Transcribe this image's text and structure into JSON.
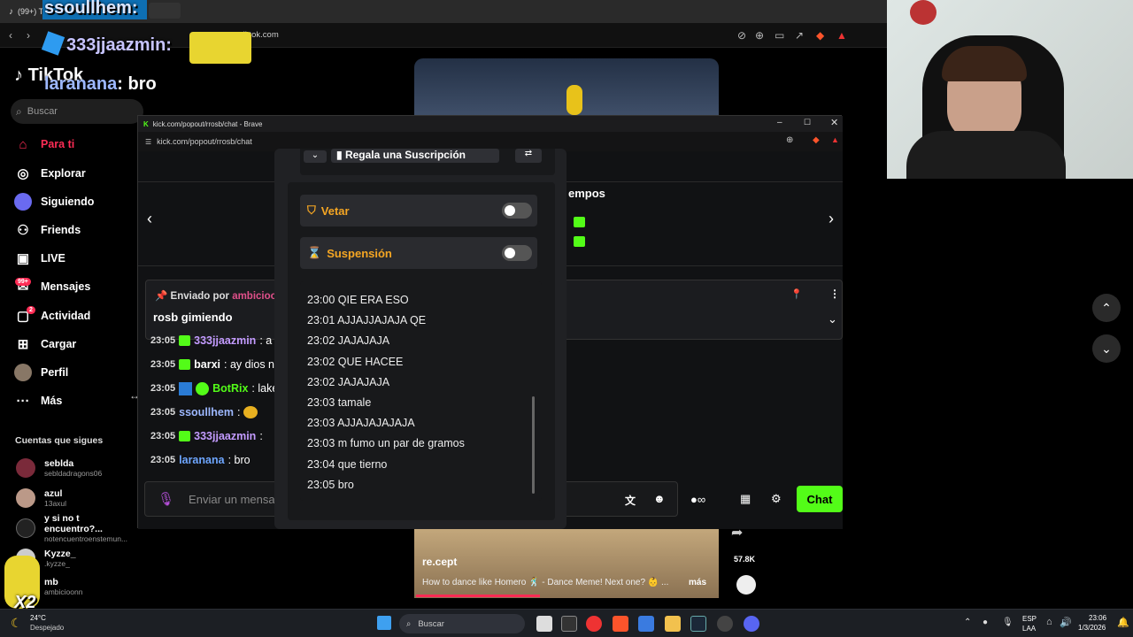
{
  "browser": {
    "tab_title": "(99+) T",
    "address": "tiktok.com"
  },
  "overlay": {
    "user1": "ssoullhem:",
    "user2": "333jjaazmin:",
    "user3_name": "laranana",
    "user3_msg": ": bro",
    "x2_label": "X2"
  },
  "tiktok": {
    "logo": "TikTok",
    "search_placeholder": "Buscar",
    "nav": [
      {
        "label": "Para ti",
        "icon": "home-icon",
        "active": true
      },
      {
        "label": "Explorar",
        "icon": "compass-icon"
      },
      {
        "label": "Siguiendo",
        "icon": "following-icon"
      },
      {
        "label": "Friends",
        "icon": "friends-icon"
      },
      {
        "label": "LIVE",
        "icon": "live-icon"
      },
      {
        "label": "Mensajes",
        "icon": "messages-icon",
        "badge": "99+"
      },
      {
        "label": "Actividad",
        "icon": "activity-icon",
        "badge": "2"
      },
      {
        "label": "Cargar",
        "icon": "upload-icon"
      },
      {
        "label": "Perfil",
        "icon": "profile-icon"
      },
      {
        "label": "Más",
        "icon": "more-icon"
      }
    ],
    "following_title": "Cuentas que sigues",
    "following": [
      {
        "name": "seblda",
        "handle": "sebldadragons06"
      },
      {
        "name": "azul",
        "handle": "13axul"
      },
      {
        "name": "y si no t encuentro?...",
        "handle": "notencuentroenstemun..."
      },
      {
        "name": "Kyzze_",
        "handle": ".kyzze_"
      },
      {
        "name": "mb",
        "handle": "ambicioonn"
      }
    ],
    "video": {
      "username": "re.cept",
      "description": "How to dance like Homero 🕺 - Dance Meme! Next one? 👶 ...",
      "more": "más",
      "share_count": "57.8K"
    }
  },
  "popup": {
    "window_title": "kick.com/popout/rrosb/chat - Brave",
    "url": "kick.com/popout/rrosb/chat",
    "top_button": "Regala una Suscripción",
    "tiempos_text": "empos",
    "pinned": {
      "label": "Enviado por",
      "author": "ambicioonn",
      "message": "rosb gimiendo"
    },
    "chat": [
      {
        "time": "23:05",
        "user": "333jjaazmin",
        "msg": ": a",
        "color": "#c39bff",
        "sub": true
      },
      {
        "time": "23:05",
        "user": "barxi",
        "msg": ": ay dios n",
        "color": "#ffffff",
        "sub": true
      },
      {
        "time": "23:05",
        "user": "BotRix",
        "msg": ": lake",
        "color": "#53fc18",
        "sub": false,
        "bot": true
      },
      {
        "time": "23:05",
        "user": "ssoullhem",
        "msg": ":",
        "color": "#9db8ff",
        "sub": false
      },
      {
        "time": "23:05",
        "user": "333jjaazmin",
        "msg": ":",
        "color": "#c39bff",
        "sub": true
      },
      {
        "time": "23:05",
        "user": "laranana",
        "msg": ": bro",
        "color": "#6ea6ff",
        "sub": false
      }
    ],
    "input_placeholder": "Enviar un mensa",
    "chat_button": "Chat"
  },
  "mod_panel": {
    "vetar": "Vetar",
    "suspension": "Suspensión",
    "history": [
      "23:00 QIE ERA ESO",
      "23:01 AJJAJJAJAJA QE",
      "23:02 JAJAJAJA",
      "23:02 QUE HACEE",
      "23:02 JAJAJAJA",
      "23:03 tamale",
      "23:03 AJJAJAJAJAJA",
      "23:03 m fumo un par de gramos",
      "23:04 que tierno",
      "23:05 bro"
    ]
  },
  "taskbar": {
    "weather_temp": "24°C",
    "weather_desc": "Despejado",
    "search": "Buscar",
    "lang1": "ESP",
    "lang2": "LAA",
    "time": "23:06",
    "date": "1/3/2026"
  }
}
